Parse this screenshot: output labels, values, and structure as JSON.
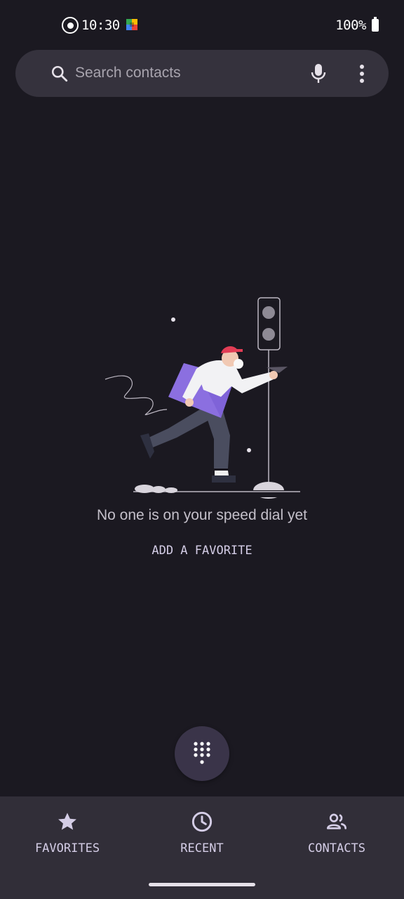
{
  "status_bar": {
    "time": "10:30",
    "battery": "100%"
  },
  "search": {
    "placeholder": "Search contacts"
  },
  "empty_state": {
    "message": "No one is on your speed dial yet",
    "action_label": "ADD A FAVORITE"
  },
  "bottom_nav": {
    "items": [
      {
        "label": "FAVORITES",
        "icon": "star-icon"
      },
      {
        "label": "RECENT",
        "icon": "clock-icon"
      },
      {
        "label": "CONTACTS",
        "icon": "people-icon"
      }
    ]
  },
  "colors": {
    "background": "#1b1921",
    "surface": "#35323d",
    "nav_background": "#312e38",
    "accent": "#d4cde6",
    "fab": "#3a3449"
  }
}
